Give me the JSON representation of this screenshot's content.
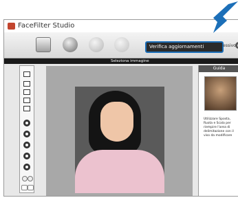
{
  "app": {
    "title": "FaceFilter Studio"
  },
  "toolbar": {
    "update_label": "Verifica aggiornamenti",
    "next_label": "essivo",
    "next_arrow_glyph": "▸"
  },
  "status": {
    "text": "Seleziona immagine"
  },
  "guide": {
    "header": "Guida",
    "text": "Utilizzare Sposta,\nRuota e Scala per\nriempire l'area di\ndelimitazione con il\nviso da modificare"
  },
  "colors": {
    "accent_blue": "#1c6fb8",
    "status_bar": "#1a1a1a"
  },
  "icons": [
    "open-document-icon",
    "face-select-icon",
    "face-filter-icon",
    "face-compare-icon",
    "next-arrow-icon",
    "callout-arrow-icon"
  ]
}
